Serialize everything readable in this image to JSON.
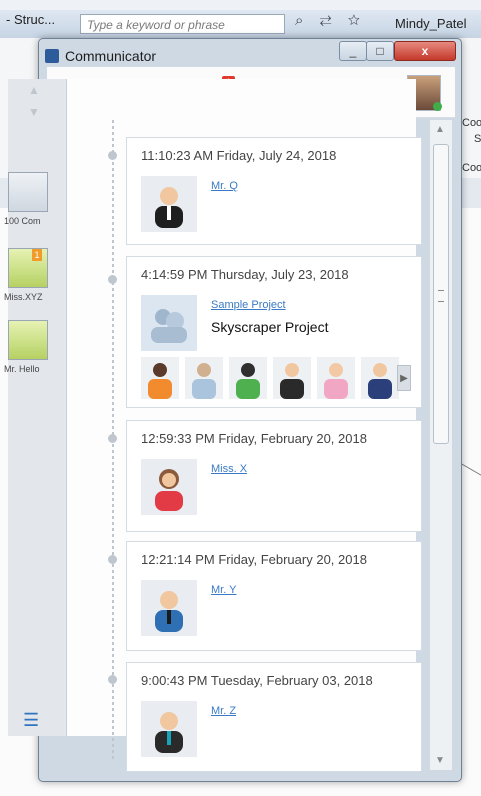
{
  "background": {
    "title": "- Struc...",
    "search_placeholder": "Type a keyword or phrase",
    "user": "Mindy_Patel",
    "right_labels": [
      "Coo",
      "S",
      "Coo"
    ]
  },
  "window": {
    "title": "Communicator",
    "close": "x",
    "min": "_",
    "max": "□",
    "toolbar_badge": "1"
  },
  "sidebar": {
    "items": [
      {
        "label": "100 Com"
      },
      {
        "label": "Miss.XYZ",
        "badge": "1"
      },
      {
        "label": "Mr. Hello"
      }
    ]
  },
  "feed": [
    {
      "time": "11:10:23 AM Friday, July 24, 2018",
      "name": "Mr. Q"
    },
    {
      "time": "4:14:59 PM Thursday, July 23, 2018",
      "name": "Sample Project",
      "subtitle": "Skyscraper Project"
    },
    {
      "time": "12:59:33 PM Friday, February 20, 2018",
      "name": "Miss. X"
    },
    {
      "time": "12:21:14 PM Friday, February 20, 2018",
      "name": "Mr. Y"
    },
    {
      "time": "9:00:43 PM Tuesday, February 03, 2018",
      "name": "Mr. Z"
    }
  ]
}
